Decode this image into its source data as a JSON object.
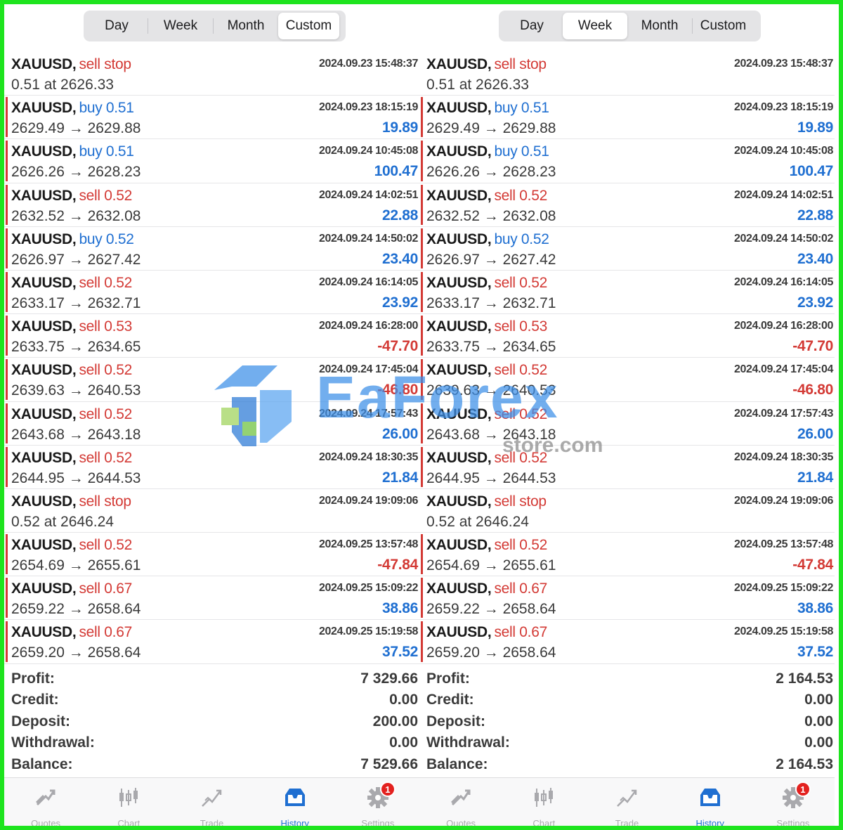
{
  "panels": [
    {
      "tabs": [
        "Day",
        "Week",
        "Month",
        "Custom"
      ],
      "active_tab": 3,
      "rows": [
        {
          "symbol": "XAUUSD",
          "action": "sell stop",
          "side": "sell",
          "time": "2024.09.23 15:48:37",
          "price": "0.51 at 2626.33",
          "pl": ""
        },
        {
          "symbol": "XAUUSD",
          "action": "buy 0.51",
          "side": "buy",
          "time": "2024.09.23 18:15:19",
          "price": "2629.49 → 2629.88",
          "pl": "19.89"
        },
        {
          "symbol": "XAUUSD",
          "action": "buy 0.51",
          "side": "buy",
          "time": "2024.09.24 10:45:08",
          "price": "2626.26 → 2628.23",
          "pl": "100.47"
        },
        {
          "symbol": "XAUUSD",
          "action": "sell 0.52",
          "side": "sell",
          "time": "2024.09.24 14:02:51",
          "price": "2632.52 → 2632.08",
          "pl": "22.88"
        },
        {
          "symbol": "XAUUSD",
          "action": "buy 0.52",
          "side": "buy",
          "time": "2024.09.24 14:50:02",
          "price": "2626.97 → 2627.42",
          "pl": "23.40"
        },
        {
          "symbol": "XAUUSD",
          "action": "sell 0.52",
          "side": "sell",
          "time": "2024.09.24 16:14:05",
          "price": "2633.17 → 2632.71",
          "pl": "23.92"
        },
        {
          "symbol": "XAUUSD",
          "action": "sell 0.53",
          "side": "sell",
          "time": "2024.09.24 16:28:00",
          "price": "2633.75 → 2634.65",
          "pl": "-47.70"
        },
        {
          "symbol": "XAUUSD",
          "action": "sell 0.52",
          "side": "sell",
          "time": "2024.09.24 17:45:04",
          "price": "2639.63 → 2640.53",
          "pl": "-46.80"
        },
        {
          "symbol": "XAUUSD",
          "action": "sell 0.52",
          "side": "sell",
          "time": "2024.09.24 17:57:43",
          "price": "2643.68 → 2643.18",
          "pl": "26.00"
        },
        {
          "symbol": "XAUUSD",
          "action": "sell 0.52",
          "side": "sell",
          "time": "2024.09.24 18:30:35",
          "price": "2644.95 → 2644.53",
          "pl": "21.84"
        },
        {
          "symbol": "XAUUSD",
          "action": "sell stop",
          "side": "sell",
          "time": "2024.09.24 19:09:06",
          "price": "0.52 at 2646.24",
          "pl": ""
        },
        {
          "symbol": "XAUUSD",
          "action": "sell 0.52",
          "side": "sell",
          "time": "2024.09.25 13:57:48",
          "price": "2654.69 → 2655.61",
          "pl": "-47.84"
        },
        {
          "symbol": "XAUUSD",
          "action": "sell 0.67",
          "side": "sell",
          "time": "2024.09.25 15:09:22",
          "price": "2659.22 → 2658.64",
          "pl": "38.86"
        },
        {
          "symbol": "XAUUSD",
          "action": "sell 0.67",
          "side": "sell",
          "time": "2024.09.25 15:19:58",
          "price": "2659.20 → 2658.64",
          "pl": "37.52"
        }
      ],
      "summary": [
        {
          "label": "Profit:",
          "value": "7 329.66"
        },
        {
          "label": "Credit:",
          "value": "0.00"
        },
        {
          "label": "Deposit:",
          "value": "200.00"
        },
        {
          "label": "Withdrawal:",
          "value": "0.00"
        },
        {
          "label": "Balance:",
          "value": "7 529.66"
        }
      ]
    },
    {
      "tabs": [
        "Day",
        "Week",
        "Month",
        "Custom"
      ],
      "active_tab": 1,
      "rows": [
        {
          "symbol": "XAUUSD",
          "action": "sell stop",
          "side": "sell",
          "time": "2024.09.23 15:48:37",
          "price": "0.51 at 2626.33",
          "pl": ""
        },
        {
          "symbol": "XAUUSD",
          "action": "buy 0.51",
          "side": "buy",
          "time": "2024.09.23 18:15:19",
          "price": "2629.49 → 2629.88",
          "pl": "19.89"
        },
        {
          "symbol": "XAUUSD",
          "action": "buy 0.51",
          "side": "buy",
          "time": "2024.09.24 10:45:08",
          "price": "2626.26 → 2628.23",
          "pl": "100.47"
        },
        {
          "symbol": "XAUUSD",
          "action": "sell 0.52",
          "side": "sell",
          "time": "2024.09.24 14:02:51",
          "price": "2632.52 → 2632.08",
          "pl": "22.88"
        },
        {
          "symbol": "XAUUSD",
          "action": "buy 0.52",
          "side": "buy",
          "time": "2024.09.24 14:50:02",
          "price": "2626.97 → 2627.42",
          "pl": "23.40"
        },
        {
          "symbol": "XAUUSD",
          "action": "sell 0.52",
          "side": "sell",
          "time": "2024.09.24 16:14:05",
          "price": "2633.17 → 2632.71",
          "pl": "23.92"
        },
        {
          "symbol": "XAUUSD",
          "action": "sell 0.53",
          "side": "sell",
          "time": "2024.09.24 16:28:00",
          "price": "2633.75 → 2634.65",
          "pl": "-47.70"
        },
        {
          "symbol": "XAUUSD",
          "action": "sell 0.52",
          "side": "sell",
          "time": "2024.09.24 17:45:04",
          "price": "2639.63 → 2640.53",
          "pl": "-46.80"
        },
        {
          "symbol": "XAUUSD",
          "action": "sell 0.52",
          "side": "sell",
          "time": "2024.09.24 17:57:43",
          "price": "2643.68 → 2643.18",
          "pl": "26.00"
        },
        {
          "symbol": "XAUUSD",
          "action": "sell 0.52",
          "side": "sell",
          "time": "2024.09.24 18:30:35",
          "price": "2644.95 → 2644.53",
          "pl": "21.84"
        },
        {
          "symbol": "XAUUSD",
          "action": "sell stop",
          "side": "sell",
          "time": "2024.09.24 19:09:06",
          "price": "0.52 at 2646.24",
          "pl": ""
        },
        {
          "symbol": "XAUUSD",
          "action": "sell 0.52",
          "side": "sell",
          "time": "2024.09.25 13:57:48",
          "price": "2654.69 → 2655.61",
          "pl": "-47.84"
        },
        {
          "symbol": "XAUUSD",
          "action": "sell 0.67",
          "side": "sell",
          "time": "2024.09.25 15:09:22",
          "price": "2659.22 → 2658.64",
          "pl": "38.86"
        },
        {
          "symbol": "XAUUSD",
          "action": "sell 0.67",
          "side": "sell",
          "time": "2024.09.25 15:19:58",
          "price": "2659.20 → 2658.64",
          "pl": "37.52"
        }
      ],
      "summary": [
        {
          "label": "Profit:",
          "value": "2 164.53"
        },
        {
          "label": "Credit:",
          "value": "0.00"
        },
        {
          "label": "Deposit:",
          "value": "0.00"
        },
        {
          "label": "Withdrawal:",
          "value": "0.00"
        },
        {
          "label": "Balance:",
          "value": "2 164.53"
        }
      ]
    }
  ],
  "tabbar": [
    {
      "label": "Quotes",
      "icon": "quotes-icon"
    },
    {
      "label": "Chart",
      "icon": "chart-icon"
    },
    {
      "label": "Trade",
      "icon": "trade-icon"
    },
    {
      "label": "History",
      "icon": "history-icon"
    },
    {
      "label": "Settings",
      "icon": "settings-icon"
    }
  ],
  "active_tabbar": 3,
  "settings_badge": "1",
  "watermark": {
    "text": "EaForex",
    "sub": "store.com"
  },
  "colors": {
    "buy": "#1f6fd1",
    "sell": "#d33a35",
    "accent": "#1f6fd1",
    "frame": "#1ee41e"
  }
}
